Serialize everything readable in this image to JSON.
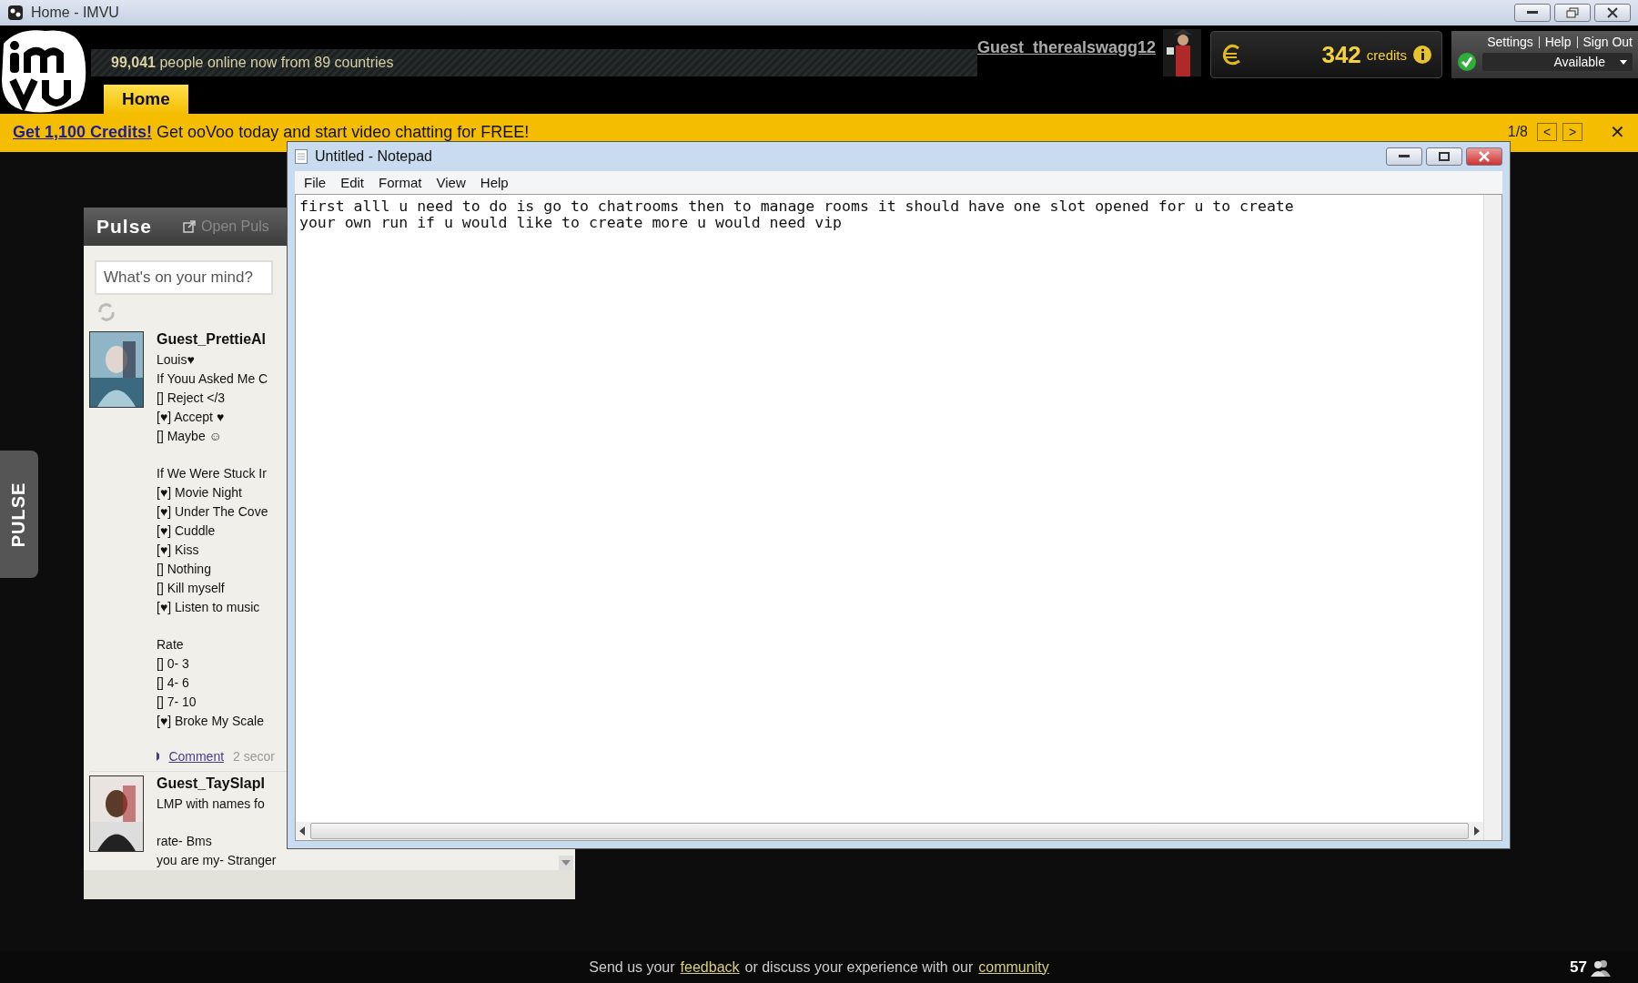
{
  "window": {
    "title": "Home - IMVU"
  },
  "header": {
    "online_count": "99,041",
    "online_text": "people online now from 89 countries",
    "username": "Guest_therealswagg12",
    "credits": "342",
    "credits_label": "credits",
    "links": [
      "Settings",
      "Help",
      "Sign Out"
    ],
    "status": "Available"
  },
  "tabs": [
    {
      "label": "Home",
      "selected": true
    }
  ],
  "banner": {
    "link": "Get 1,100 Credits!",
    "text": "Get ooVoo today and start video chatting for FREE!",
    "pager": "1/8",
    "prev": "<",
    "next": ">",
    "close": "✕"
  },
  "side_tab": "PULSE",
  "pulse": {
    "title": "Pulse",
    "open_link": "Open Puls",
    "placeholder": "What's on your mind?",
    "posts": [
      {
        "author": "Guest_PrettieAl",
        "paragraphs": [
          [
            "Louis♥",
            "If Youu Asked Me C",
            "[] Reject </3",
            "[♥] Accept ♥",
            "[] Maybe ☺"
          ],
          [
            "If We Were Stuck Ir",
            "[♥] Movie Night",
            "[♥] Under The Cove",
            "[♥] Cuddle",
            "[♥] Kiss",
            "[] Nothing",
            "[] Kill myself",
            "[♥] Listen to music"
          ],
          [
            "Rate",
            "[] 0- 3",
            "[] 4- 6",
            "[] 7- 10",
            "[♥] Broke My Scale"
          ]
        ],
        "comment": "Comment",
        "time": "2 secor"
      },
      {
        "author": "Guest_TaySlapI",
        "paragraphs": [
          [
            "LMP with names fo"
          ],
          [
            "rate- Bms",
            "you are my- Stranger"
          ]
        ]
      }
    ]
  },
  "notepad": {
    "title": "Untitled - Notepad",
    "menu": [
      "File",
      "Edit",
      "Format",
      "View",
      "Help"
    ],
    "lines": [
      "first alll u need to do is go to chatrooms then to manage rooms it should have one slot opened for u to create",
      "your own run if u would like to create more u would need vip"
    ]
  },
  "footer": {
    "parts": [
      {
        "kind": "text",
        "text": "Send us your"
      },
      {
        "kind": "link",
        "text": "feedback"
      },
      {
        "kind": "text",
        "text": "or discuss your experience with our"
      },
      {
        "kind": "link",
        "text": "community"
      }
    ],
    "count": "57"
  }
}
